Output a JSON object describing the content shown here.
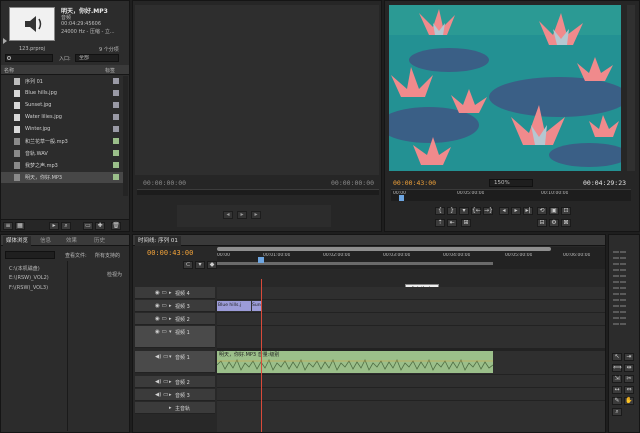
{
  "project": {
    "preview_name": "明天，你好.MP3",
    "preview_type": "音频",
    "preview_duration": "00:04:29:45606",
    "preview_format": "24000 Hz - 压缩 - 立...",
    "project_file": "123.prproj",
    "item_count": "9 个分项",
    "in_label": "入口:",
    "in_value": "全部",
    "col_name": "名称",
    "col_label": "标签",
    "items": [
      {
        "name": "序列 01",
        "icon": "sequence-icon"
      },
      {
        "name": "Blue hills.jpg",
        "icon": "image-icon"
      },
      {
        "name": "Sunset.jpg",
        "icon": "image-icon"
      },
      {
        "name": "Water lilies.jpg",
        "icon": "image-icon"
      },
      {
        "name": "Winter.jpg",
        "icon": "image-icon"
      },
      {
        "name": "和兰花草一般.mp3",
        "icon": "audio-icon"
      },
      {
        "name": "音轨.WAV",
        "icon": "audio-icon"
      },
      {
        "name": "我梦之声.mp3",
        "icon": "audio-icon"
      },
      {
        "name": "明天，你好.MP3",
        "icon": "audio-icon"
      }
    ]
  },
  "source": {
    "tc_left": "00:00:00:00",
    "tc_right": "00:00:00:00"
  },
  "program": {
    "tc_current": "00:00:43:00",
    "zoom": "150%",
    "tc_total": "00:04:29:23",
    "ruler": [
      "00:00",
      "00:05:00:00",
      "00:10:00:00"
    ]
  },
  "effects": {
    "tabs": [
      "媒体浏览",
      "信息",
      "效果",
      "历史"
    ],
    "view_label": "查看文件:",
    "view_value": "所有支持的",
    "drives": [
      "C:\\(本机磁盘)",
      "E:\\(RSW)_VOL2)",
      "F:\\(RSW)_VOL3)"
    ],
    "col_right": "检视为"
  },
  "timeline": {
    "tab": "时间线: 序列 01",
    "tc": "00:00:43:00",
    "ruler": [
      "00:00",
      "00:01:00:00",
      "00:02:00:00",
      "00:03:00:00",
      "00:04:00:00",
      "00:05:00:00",
      "00:06:00:00"
    ],
    "tooltip": "distribute",
    "tracks": [
      {
        "label": "视频 4"
      },
      {
        "label": "视频 3"
      },
      {
        "label": "视频 2"
      },
      {
        "label": "视频 1"
      },
      {
        "label": "音频 1"
      },
      {
        "label": "音频 2"
      },
      {
        "label": "音频 3"
      },
      {
        "label": "主音轨"
      }
    ],
    "video_clip": "Blue hills.j",
    "video_clip_tail": "Sunse",
    "audio_clip": "明天，你好.MP3  音量:级别"
  },
  "colors": {
    "accent": "#f2a33a",
    "audio_clip": "#9bbf8a",
    "video_clip": "#9c9cd8",
    "playhead": "#d94a3a"
  }
}
